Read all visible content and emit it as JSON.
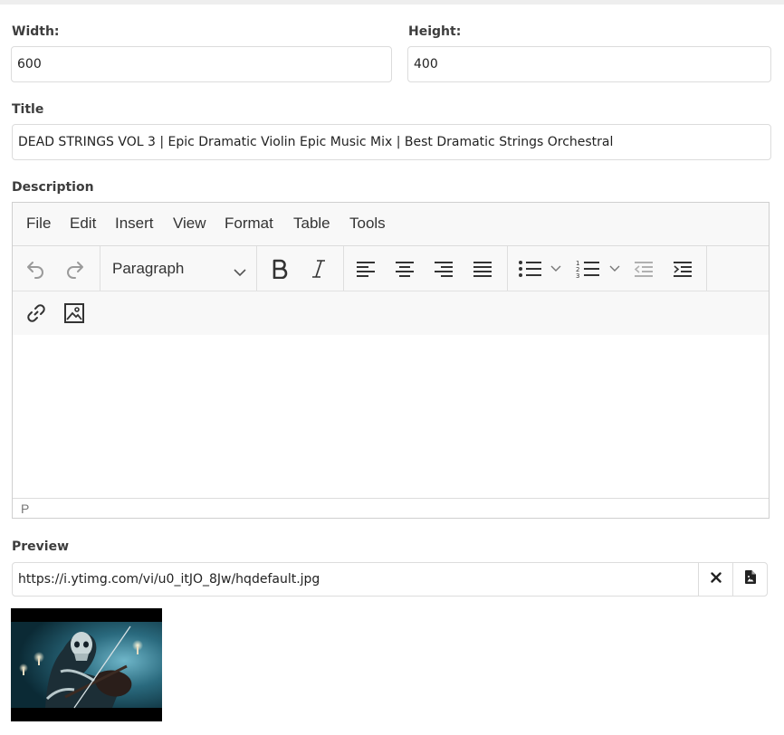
{
  "form": {
    "width_label": "Width:",
    "width_value": "600",
    "height_label": "Height:",
    "height_value": "400",
    "title_label": "Title",
    "title_value": "DEAD STRINGS VOL 3 | Epic Dramatic Violin Epic Music Mix | Best Dramatic Strings Orchestral",
    "description_label": "Description",
    "preview_label": "Preview",
    "preview_url": "https://i.ytimg.com/vi/u0_itJO_8Jw/hqdefault.jpg"
  },
  "editor": {
    "menu": [
      "File",
      "Edit",
      "Insert",
      "View",
      "Format",
      "Table",
      "Tools"
    ],
    "block_format": "Paragraph",
    "status_path": "P",
    "toolbar_icons": [
      "undo-icon",
      "redo-icon",
      "bold-icon",
      "italic-icon",
      "align-left-icon",
      "align-center-icon",
      "align-right-icon",
      "align-justify-icon",
      "bullet-list-icon",
      "numbered-list-icon",
      "outdent-icon",
      "indent-icon",
      "link-icon",
      "image-icon"
    ]
  },
  "preview": {
    "clear_icon": "close-icon",
    "browse_icon": "file-image-icon",
    "thumbnail": "violin-skeleton-thumbnail"
  },
  "colors": {
    "label": "#3d3d3d",
    "border": "#dcdcdc",
    "toolbar_bg": "#f8f8f8"
  }
}
